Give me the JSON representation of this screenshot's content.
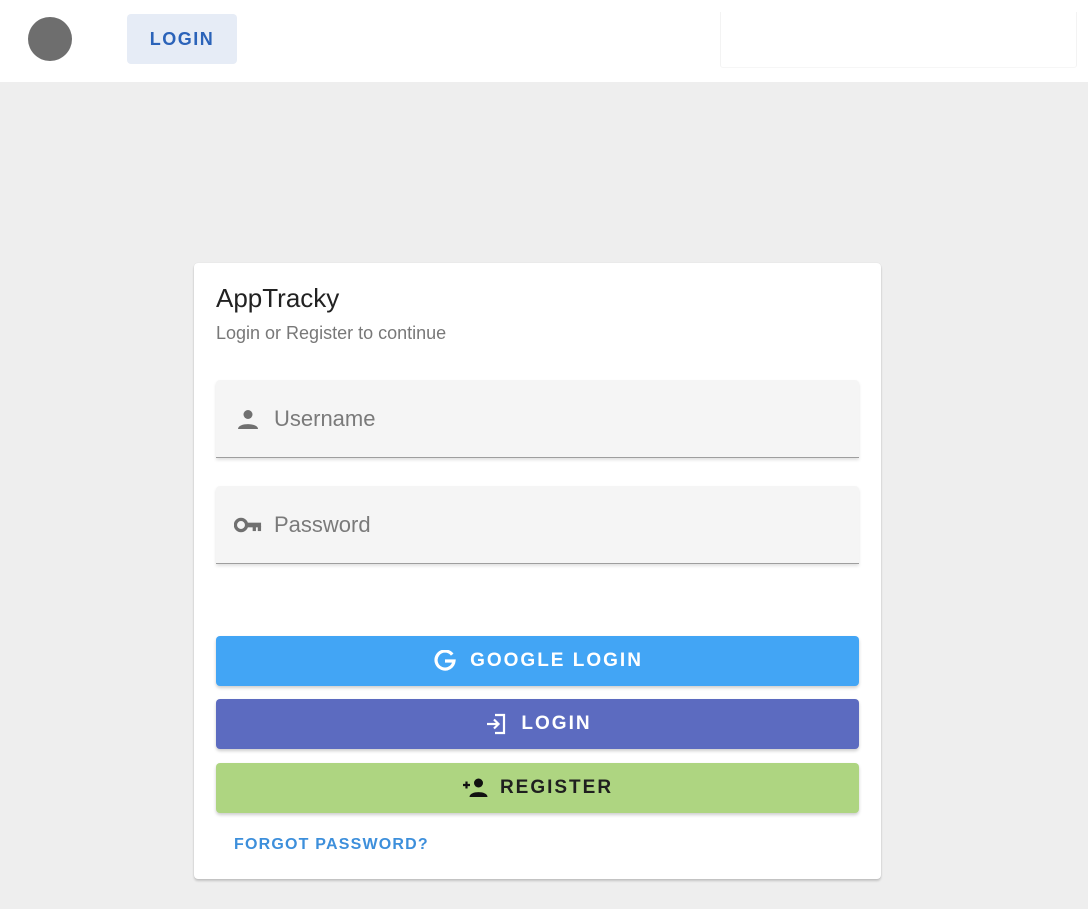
{
  "header": {
    "login_label": "LOGIN"
  },
  "card": {
    "title": "AppTracky",
    "subtitle": "Login or Register to continue",
    "username": {
      "placeholder": "Username",
      "value": "",
      "icon": "person-icon"
    },
    "password": {
      "placeholder": "Password",
      "value": "",
      "icon": "key-icon"
    },
    "google_login_label": "GOOGLE LOGIN",
    "login_label": "LOGIN",
    "register_label": "REGISTER",
    "forgot_password_label": "FORGOT PASSWORD?"
  },
  "colors": {
    "background": "#eeeeee",
    "google_button": "#42a5f5",
    "login_button": "#5c6bc0",
    "register_button": "#aed581",
    "link": "#3d8fdb",
    "header_button": "#e6ecf6",
    "header_button_text": "#2b63b9"
  }
}
